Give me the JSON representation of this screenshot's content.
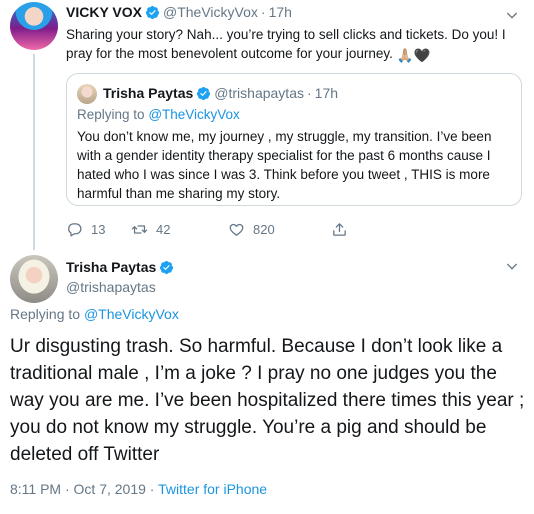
{
  "quote_tweet": {
    "author_name": "VICKY VOX",
    "handle": "@TheVickyVox",
    "time": "17h",
    "text": "Sharing your story? Nah... you’re trying to sell clicks and tickets. Do you! I pray for the most benevolent outcome for your journey.",
    "emoji": "🙏🏼🖤",
    "quoted": {
      "author_name": "Trisha Paytas",
      "handle": "@trishapaytas",
      "time": "17h",
      "replying_prefix": "Replying to",
      "replying_handle": "@TheVickyVox",
      "text": "You don’t know me, my journey , my struggle, my transition. I’ve been with a gender identity therapy specialist for the past 6 months cause I hated who I was since I was 3. Think before you tweet , THIS is more harmful than me sharing my story."
    },
    "actions": {
      "reply_count": "13",
      "retweet_count": "42",
      "like_count": "820"
    }
  },
  "main_tweet": {
    "author_name": "Trisha Paytas",
    "handle": "@trishapaytas",
    "replying_prefix": "Replying to",
    "replying_handle": "@TheVickyVox",
    "text": "Ur disgusting trash. So harmful. Because I don’t look like a traditional male , I’m a joke ? I pray no one judges you the way you are me. I’ve been hospitalized there times this year ; you do not know my struggle. You’re a pig and should be deleted off Twitter",
    "timestamp": "8:11 PM · Oct 7, 2019 ·",
    "source": "Twitter for iPhone"
  },
  "colors": {
    "verified": "#1da1f2",
    "link": "#1b95e0",
    "muted": "#657786",
    "border": "#cfd9de"
  },
  "icons": [
    "verified-badge-icon",
    "chevron-down-icon",
    "reply-icon",
    "retweet-icon",
    "like-icon",
    "share-icon"
  ]
}
